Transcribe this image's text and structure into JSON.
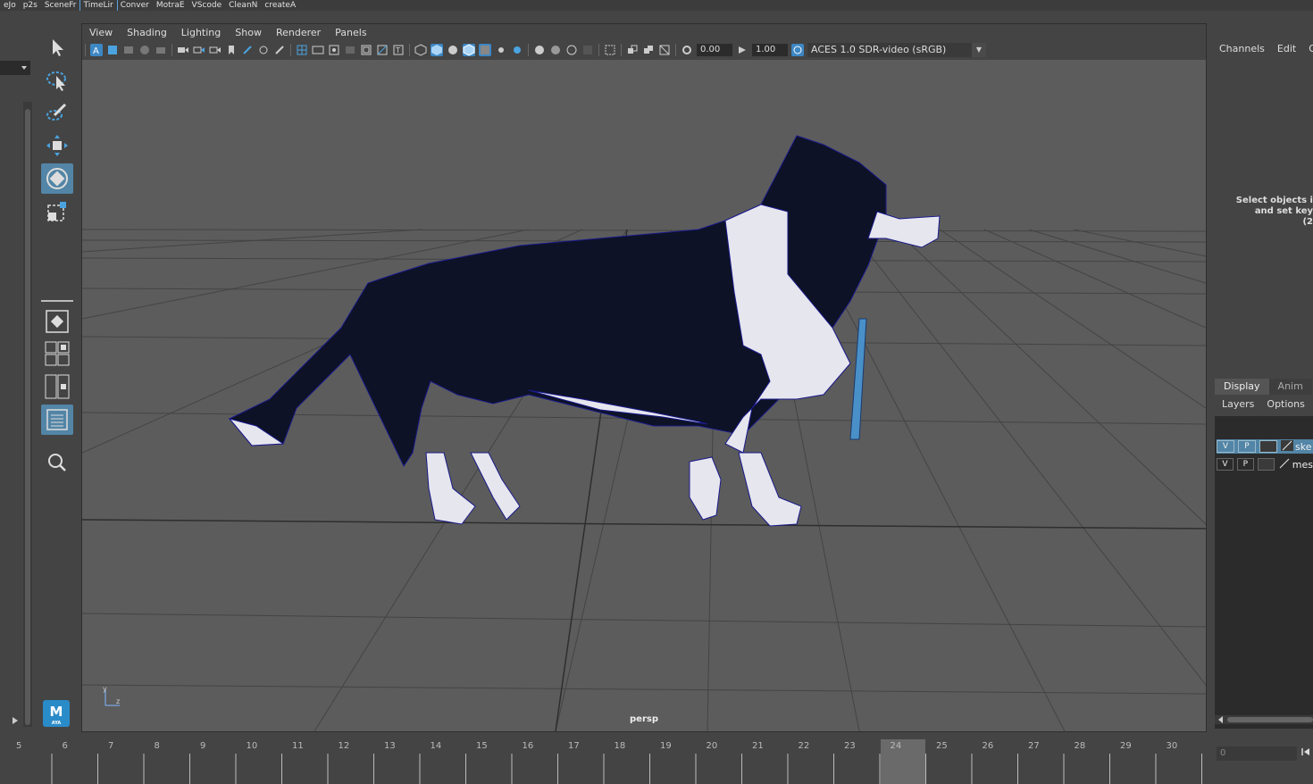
{
  "shelf": [
    "eJo",
    "p2s",
    "SceneFr",
    "TimeLir",
    "Conver",
    "MotraE",
    "VScode",
    "CleanN",
    "createA"
  ],
  "panel": {
    "menu": [
      "View",
      "Shading",
      "Lighting",
      "Show",
      "Renderer",
      "Panels"
    ],
    "exposure": "0.00",
    "gamma": "1.00",
    "color_space": "ACES 1.0 SDR-video (sRGB)",
    "camera": "persp"
  },
  "axis": {
    "y": "y",
    "z": "z"
  },
  "channel_box": {
    "tabs": [
      "Channels",
      "Edit",
      "O"
    ],
    "message": "Select objects i\nand set key\n(2"
  },
  "layer_editor": {
    "tabs": [
      "Display",
      "Anim"
    ],
    "menu": [
      "Layers",
      "Options"
    ],
    "layers": [
      {
        "v": "V",
        "p": "P",
        "name": "ske",
        "selected": true
      },
      {
        "v": "V",
        "p": "P",
        "name": "mes",
        "selected": false
      }
    ]
  },
  "timeline": {
    "frames": [
      "5",
      "6",
      "7",
      "8",
      "9",
      "10",
      "11",
      "12",
      "13",
      "14",
      "15",
      "16",
      "17",
      "18",
      "19",
      "20",
      "21",
      "22",
      "23",
      "24",
      "25",
      "26",
      "27",
      "28",
      "29",
      "30"
    ],
    "current": "24"
  },
  "range": {
    "start": "0"
  },
  "colors": {
    "accent": "#5285a6",
    "mesh_dark": "#0d1226",
    "mesh_light": "#e6e6ee",
    "wire": "#1a1a8c",
    "leash": "#4a90c8"
  }
}
